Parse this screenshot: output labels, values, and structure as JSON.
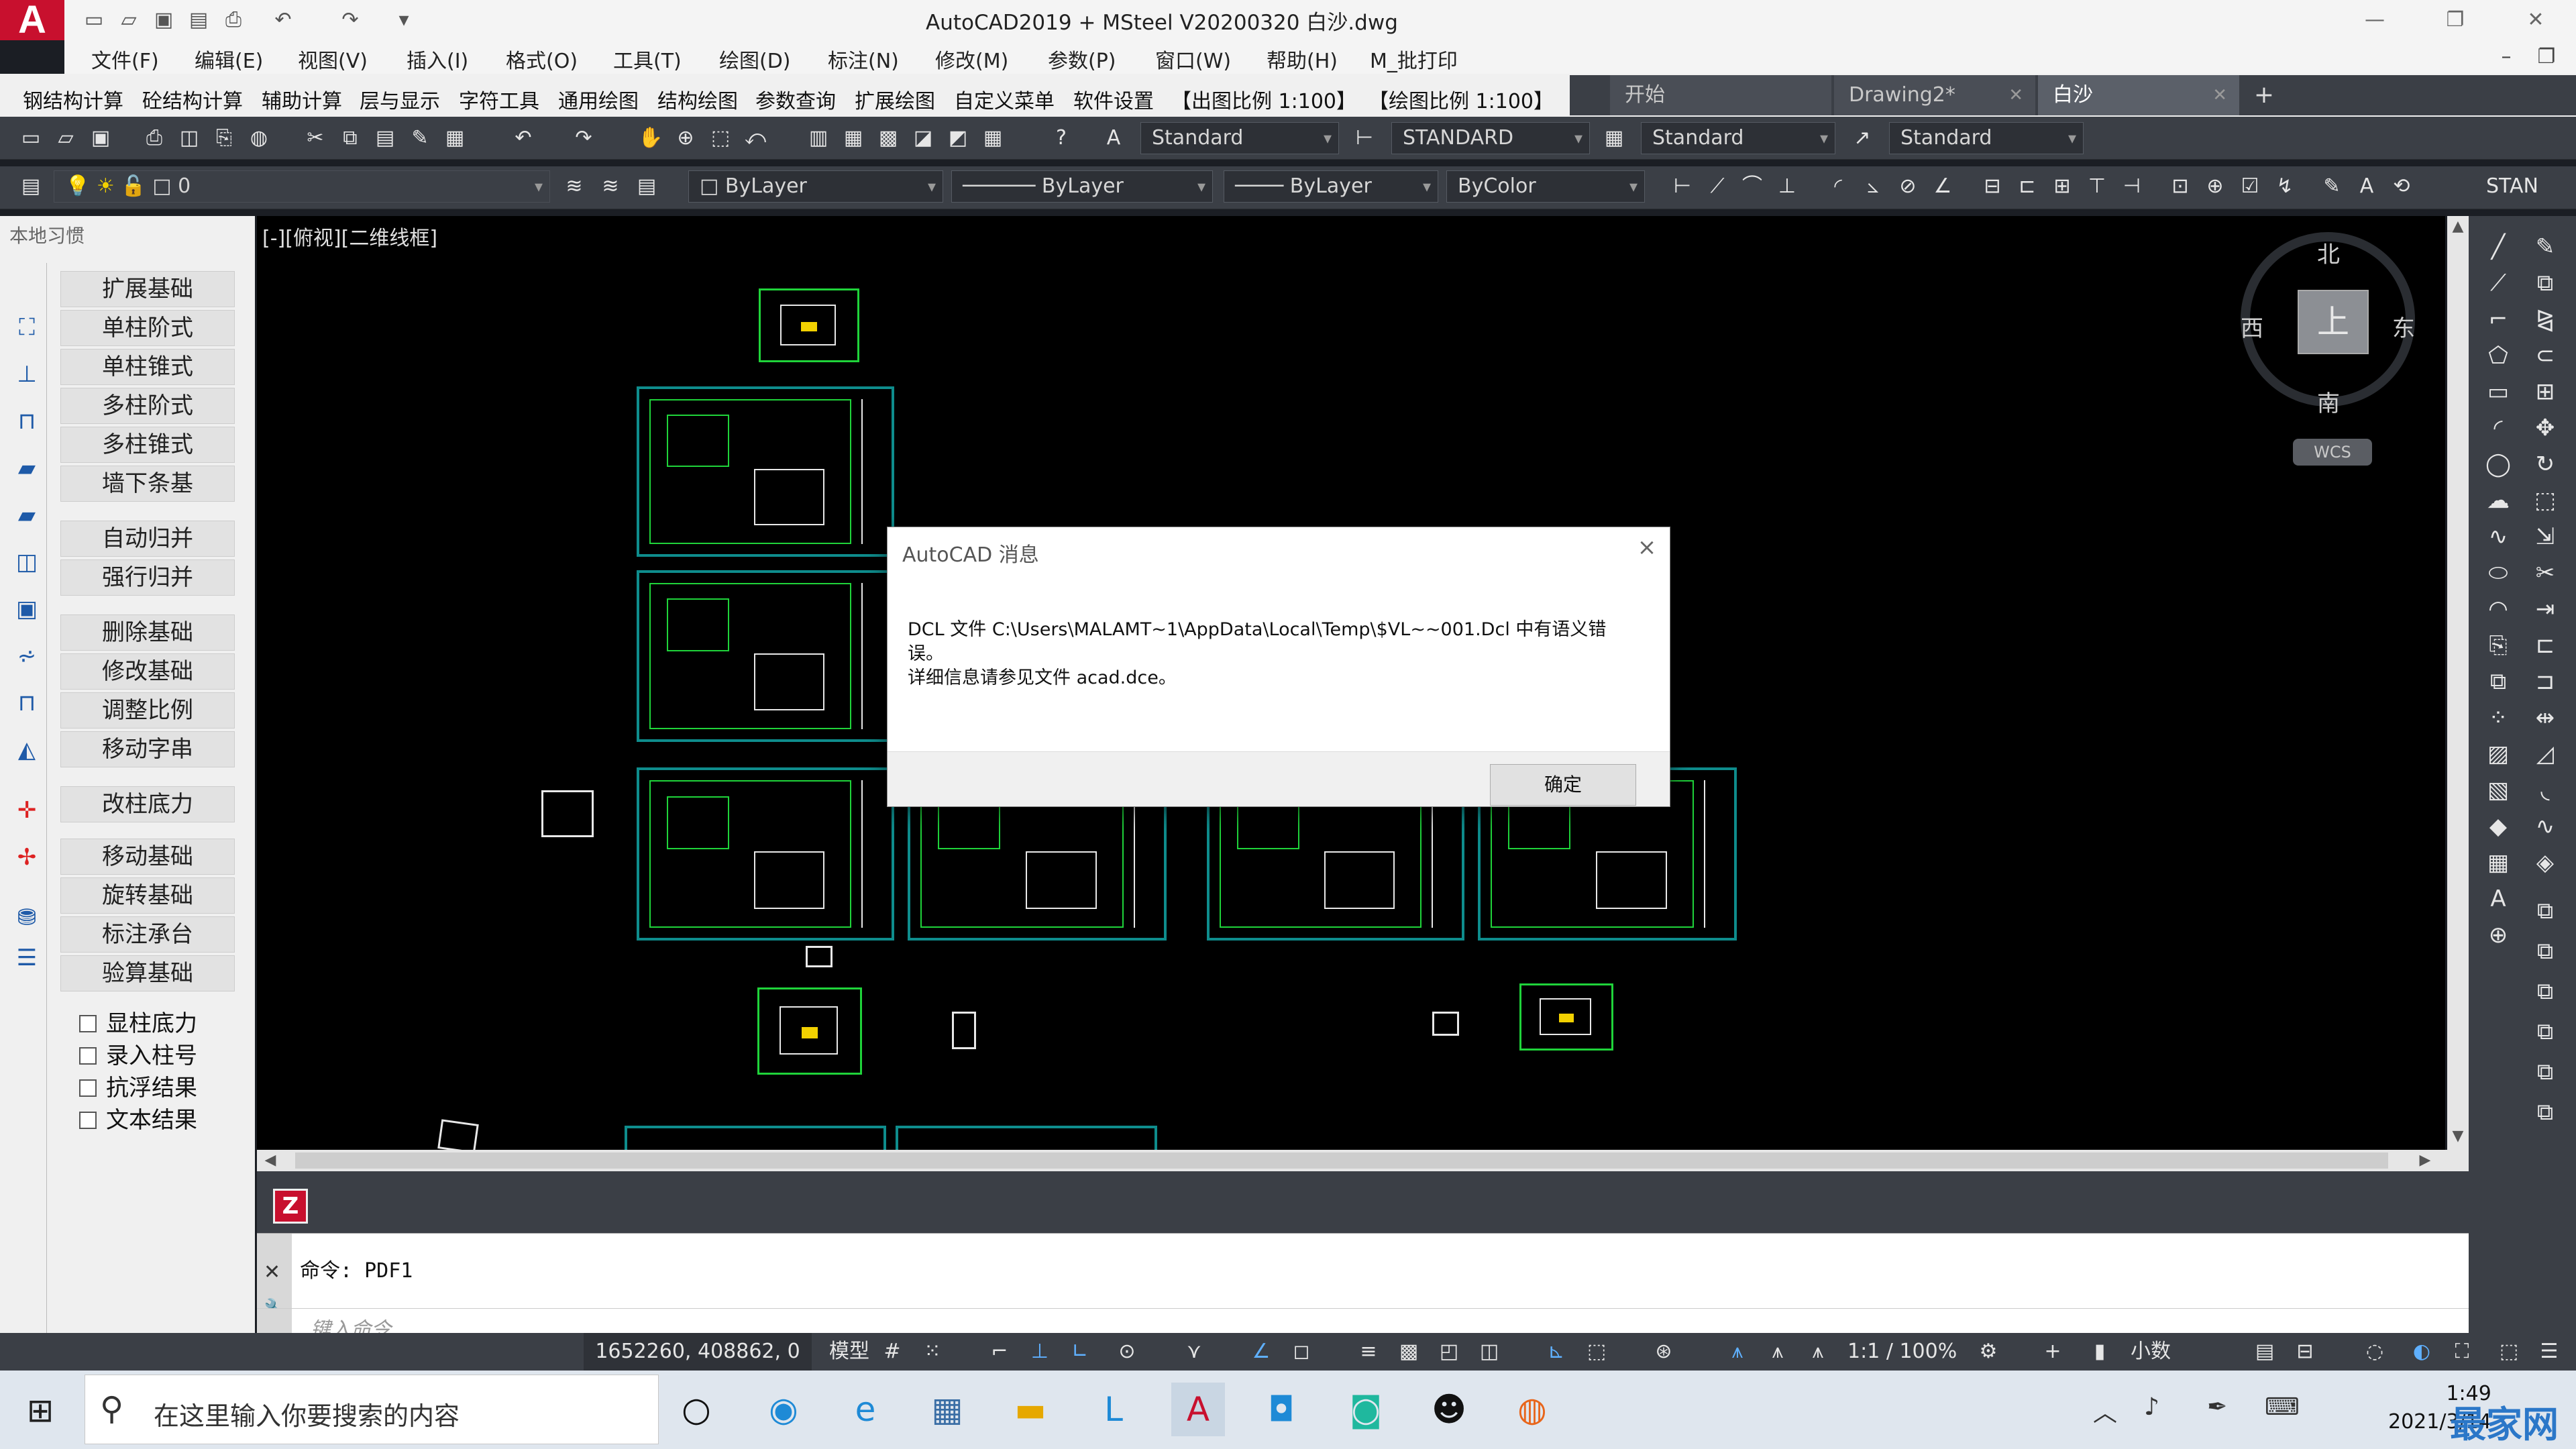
{
  "window": {
    "title": "AutoCAD2019 + MSteel V20200320    白沙.dwg",
    "app_logo": "A"
  },
  "menu": [
    "文件(F)",
    "编辑(E)",
    "视图(V)",
    "插入(I)",
    "格式(O)",
    "工具(T)",
    "绘图(D)",
    "标注(N)",
    "修改(M)",
    "参数(P)",
    "窗口(W)",
    "帮助(H)",
    "M_批打印"
  ],
  "ribbon": {
    "items": [
      "钢结构计算",
      "砼结构计算",
      "辅助计算",
      "层与显示",
      "字符工具",
      "通用绘图",
      "结构绘图",
      "参数查询",
      "扩展绘图",
      "自定义菜单",
      "软件设置",
      "【出图比例 1:100】",
      "【绘图比例 1:100】"
    ]
  },
  "doc_tabs": [
    {
      "label": "开始"
    },
    {
      "label": "Drawing2*"
    },
    {
      "label": "白沙",
      "active": true
    }
  ],
  "doc_tabs_add": "+",
  "toolbar1": {
    "text_style": "Standard",
    "dim_style": "STANDARD",
    "table_style": "Standard",
    "mleader_style": "Standard"
  },
  "toolbar2": {
    "layer": "0",
    "color": "ByLayer",
    "linetype": "ByLayer",
    "lineweight": "ByLayer",
    "plot_style": "ByColor",
    "far_right": "STAN"
  },
  "left_panel": {
    "title": "本地习惯",
    "group1": [
      "扩展基础",
      "单柱阶式",
      "单柱锥式",
      "多柱阶式",
      "多柱锥式",
      "墙下条基"
    ],
    "group2": [
      "自动归并",
      "强行归并"
    ],
    "group3": [
      "删除基础",
      "修改基础",
      "调整比例",
      "移动字串"
    ],
    "group4": [
      "改柱底力"
    ],
    "group5": [
      "移动基础",
      "旋转基础",
      "标注承台",
      "验算基础"
    ],
    "checkboxes": [
      "显柱底力",
      "录入柱号",
      "抗浮结果",
      "文本结果"
    ]
  },
  "viewport": {
    "label": "[-][俯视][二维线框]",
    "viewcube": {
      "north": "北",
      "south": "南",
      "east": "东",
      "west": "西",
      "top": "上",
      "ucs": "WCS"
    }
  },
  "dialog": {
    "title": "AutoCAD 消息",
    "message": "DCL 文件 C:\\Users\\MALAMT~1\\AppData\\Local\\Temp\\$VL~~001.Dcl 中有语义错\n误。\n详细信息请参见文件 acad.dce。",
    "ok_label": "确定",
    "close": "×"
  },
  "command": {
    "history": "命令: PDF1",
    "placeholder": "键入命令"
  },
  "status": {
    "coords": "1652260, 408862, 0",
    "model": "模型",
    "scale": "1:1 / 100%",
    "units": "小数"
  },
  "taskbar": {
    "search_placeholder": "在这里输入你要搜索的内容",
    "time": "1:49",
    "date": "2021/3/14"
  },
  "watermark": "最家网"
}
